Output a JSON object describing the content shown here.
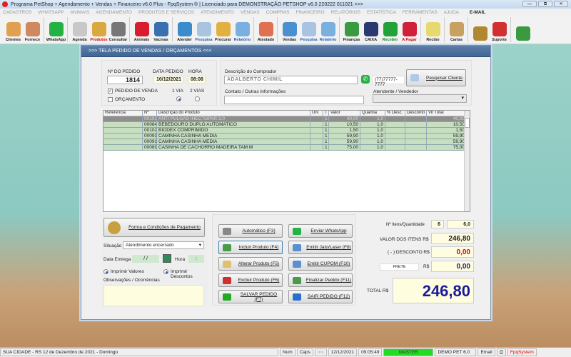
{
  "window": {
    "title": "Programa PetShop + Agendamento + Vendas + Financeiro v6.0 Plus - FpqSystem ® | Licenciado para  DEMONSTRAÇÃO PETSHOP v6.0 220222 011021 >>>",
    "min": "▭",
    "max": "⧉",
    "close": "✕"
  },
  "menu": [
    "CADASTROS",
    "WHATSAPP",
    "ANIMAIS",
    "AGENDAMENTO",
    "PRODUTOS E SERVIÇOS",
    "ATENDIMENTO",
    "VENDAS",
    "COMPRAS",
    "FINANCEIRO",
    "RELATÓRIOS",
    "ESTATÍSTICA",
    "FERRAMENTAS",
    "AJUDA",
    "E-MAIL"
  ],
  "toolbar": [
    {
      "label": "Clientes",
      "color": "#e0a050"
    },
    {
      "label": "Fornece",
      "color": "#d08860"
    },
    {
      "sep": true
    },
    {
      "label": "WhatsApp",
      "color": "#25b244"
    },
    {
      "sep": true
    },
    {
      "label": "Agenda",
      "color": "#c8c8c8"
    },
    {
      "label": "Produtos",
      "color": "#d9a840",
      "labelColor": "#c00"
    },
    {
      "label": "Consultar",
      "color": "#777"
    },
    {
      "sep": true
    },
    {
      "label": "Animais",
      "color": "#d81e2e"
    },
    {
      "label": "Vacinas",
      "color": "#3a6fb0"
    },
    {
      "sep": true
    },
    {
      "label": "Atender",
      "color": "#3a8ccc"
    },
    {
      "label": "Pesquisa",
      "color": "#a9c4e0",
      "labelColor": "#2a5fa8"
    },
    {
      "label": "Procurar",
      "color": "#e2b040"
    },
    {
      "label": "Relatório",
      "color": "#7ab0e0",
      "labelColor": "#2a5fa8"
    },
    {
      "sep": true
    },
    {
      "label": "Atestado",
      "color": "#e07050"
    },
    {
      "sep": true
    },
    {
      "label": "Vendas",
      "color": "#4a90d0"
    },
    {
      "label": "Pesquisa",
      "color": "#a9c4e0",
      "labelColor": "#2a5fa8"
    },
    {
      "label": "Relatório",
      "color": "#7ab0e0",
      "labelColor": "#2a5fa8"
    },
    {
      "sep": true
    },
    {
      "label": "Finanças",
      "color": "#3a9a40"
    },
    {
      "label": "CAIXA",
      "color": "#2a3a70"
    },
    {
      "label": "Receber",
      "color": "#22a33a",
      "labelColor": "#1a7a2a"
    },
    {
      "label": "A Pagar",
      "color": "#d0203a",
      "labelColor": "#c00"
    },
    {
      "sep": true
    },
    {
      "label": "Recibo",
      "color": "#e8d870"
    },
    {
      "sep": true
    },
    {
      "label": "Cartas",
      "color": "#c8a060"
    },
    {
      "sep": true
    },
    {
      "label": "",
      "color": "#b08830"
    },
    {
      "label": "Suporte",
      "color": "#d03030"
    },
    {
      "sep": true
    },
    {
      "label": "",
      "color": "#3a9a40"
    }
  ],
  "dialog": {
    "title": ">>>  TELA PEDIDO DE VENDAS / ORÇAMENTOS  <<<",
    "order_no_label": "Nº DO PEDIDO",
    "order_no": "1814",
    "date_label": "DATA PEDIDO",
    "date": "10/12/2021",
    "time_label": "HORA",
    "time": "08:08",
    "sale_order": "PEDIDO DE VENDA",
    "quote": "ORÇAMENTO",
    "via1": "1 VIA",
    "via2": "2 VIAS",
    "buyer_label": "Descrição do Comprador",
    "buyer": "ADALBERTO CHIMIL",
    "phone": "(77)77777-7777",
    "search_client": "Pesquisar Cliente",
    "contact_label": "Contato / Outras Informações",
    "contact": "",
    "seller_label": "Atendente / Vendedor",
    "seller": "",
    "columns": [
      "Referencia",
      "Nº",
      "Descrição do Produto",
      "Uni",
      "T",
      "Valor",
      "Quantia",
      "% Desc.",
      "Desconto",
      "Vlr Total"
    ],
    "rows": [
      [
        "",
        "001031",
        "ANTI PULGAS IHECTOPAR 3.0",
        "",
        "1",
        "40,00",
        "1,0",
        "",
        "",
        "40,00"
      ],
      [
        "",
        "000842",
        "BEBEDOURO DUPLO AUTOMATICO",
        "",
        "1",
        "10,50",
        "1,0",
        "",
        "",
        "10,50"
      ],
      [
        "",
        "001021",
        "BIODEX COMPRIMIDO",
        "",
        "1",
        "1,50",
        "1,0",
        "",
        "",
        "1,50"
      ],
      [
        "",
        "000918",
        "CAMINHA CASINHA MEDIA",
        "",
        "1",
        "59,90",
        "1,0",
        "",
        "",
        "59,90"
      ],
      [
        "",
        "000918",
        "CAMINHA CASINHA MEDIA",
        "",
        "1",
        "59,90",
        "1,0",
        "",
        "",
        "59,90"
      ],
      [
        "",
        "000890",
        "CASINHA DE CACHORRO MADEIRA TAM M",
        "",
        "1",
        "75,00",
        "1,0",
        "",
        "",
        "75,00"
      ]
    ],
    "payment_btn": "Forma e Condições de Pagamento",
    "status_label": "Situação",
    "status": "Atendimento encerrado",
    "delivery_label": "Data Entrega",
    "delivery": " / /",
    "hour_label": "Hora",
    "hour": " :",
    "print_values": "Imprimir Valores",
    "print_discounts": "Imprimir Descontos",
    "notes_label": "Observações / Ocorrências",
    "notes": "",
    "buttons": [
      "Automático    (F3)",
      "Incluir Produto  (F4)",
      "Alterar Produto  (F5)",
      "Excluir Produto  (F6)",
      "SALVAR PEDIDO (F7)",
      "Enviar WhatsApp",
      "Emitir Jato/Laser (F8)",
      "Emitir CUPOM   (F10)",
      "Finalizar Pedido  (F11)",
      "SAIR  PEDIDO  (F12)"
    ],
    "items_label": "Nº Itens/Quantidade",
    "items": "6",
    "qty": "6,0",
    "value_label": "VALOR DOS ITENS R$",
    "value": "246,80",
    "discount_label": "( - ) DESCONTO R$",
    "discount": "0,00",
    "freight_label": "FRETE",
    "freight_currency": "R$",
    "freight": "0,00",
    "total_label": "TOTAL R$",
    "total": "246,80"
  },
  "statusbar": {
    "city": "SUA CIDADE - RS 12 de Dezembro de 2021 - Domingo",
    "num": "Num",
    "caps": "Caps",
    "ins": "Ins",
    "date": "12/12/2021",
    "time": "09:05:49",
    "user": "MASTER",
    "company": "DEMO PET 6.0",
    "email": "Email",
    "brand": "FpqSystem"
  }
}
